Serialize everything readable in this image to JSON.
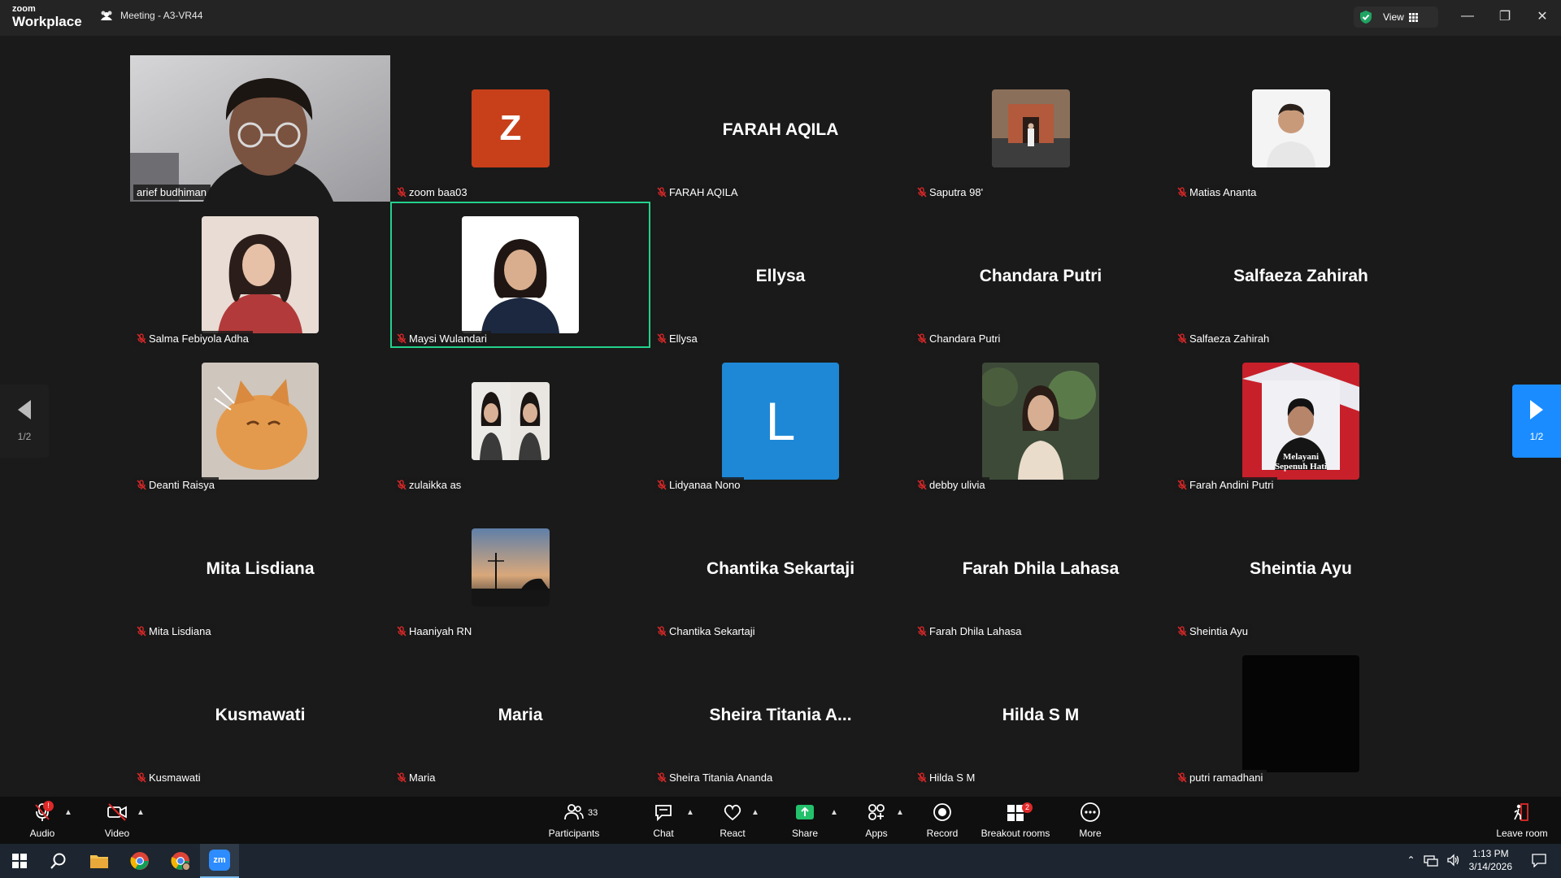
{
  "app": {
    "logo_small": "zoom",
    "logo_big": "Workplace",
    "meeting_title": "Meeting - A3-VR44",
    "view_label": "View"
  },
  "colors": {
    "active_speaker": "#23d18b",
    "zoom_blue": "#1a8cff",
    "mute_red": "#e02828"
  },
  "participants": [
    {
      "name": "arief budhiman",
      "type": "video"
    },
    {
      "name": "zoom baa03",
      "type": "initial",
      "initial": "Z",
      "color": "#c8401a"
    },
    {
      "name": "FARAH AQILA",
      "type": "text"
    },
    {
      "name": "Saputra 98'",
      "type": "photo",
      "photo": "building"
    },
    {
      "name": "Matias Ananta",
      "type": "photo",
      "photo": "portrait-male"
    },
    {
      "name": "Salma Febiyola Adha",
      "type": "photo-big",
      "photo": "portrait-red"
    },
    {
      "name": "Maysi Wulandari",
      "type": "photo-big",
      "photo": "portrait-white",
      "active": true
    },
    {
      "name": "Ellysa",
      "type": "text"
    },
    {
      "name": "Chandara Putri",
      "type": "text"
    },
    {
      "name": "Salfaeza Zahirah",
      "type": "text"
    },
    {
      "name": "Deanti Raisya",
      "type": "photo-big",
      "photo": "cat"
    },
    {
      "name": "zulaikka as",
      "type": "photo",
      "photo": "two-portraits"
    },
    {
      "name": "Lidyanaa Nono",
      "type": "initial-big",
      "initial": "L",
      "color": "#1e88d6"
    },
    {
      "name": "debby ulivia",
      "type": "photo-big",
      "photo": "plants"
    },
    {
      "name": "Farah Andini Putri",
      "type": "photo-big",
      "photo": "poster",
      "caption": "Melayani Sepenuh Hati"
    },
    {
      "name": "Mita Lisdiana",
      "type": "text"
    },
    {
      "name": "Haaniyah RN",
      "type": "photo",
      "photo": "sunset"
    },
    {
      "name": "Chantika Sekartaji",
      "type": "text"
    },
    {
      "name": "Farah Dhila Lahasa",
      "type": "text"
    },
    {
      "name": "Sheintia Ayu",
      "type": "text"
    },
    {
      "name": "Kusmawati",
      "type": "text"
    },
    {
      "name": "Maria",
      "type": "text"
    },
    {
      "name": "Sheira Titania Ananda",
      "type": "text",
      "display": "Sheira Titania A..."
    },
    {
      "name": "Hilda S M",
      "type": "text"
    },
    {
      "name": "putri ramadhani",
      "type": "photo-big",
      "photo": "black"
    }
  ],
  "pagination": {
    "left_label": "1/2",
    "right_label": "1/2"
  },
  "toolbar": {
    "audio": "Audio",
    "video": "Video",
    "participants": "Participants",
    "participants_count": "33",
    "chat": "Chat",
    "react": "React",
    "share": "Share",
    "apps": "Apps",
    "record": "Record",
    "breakout": "Breakout rooms",
    "breakout_badge": "2",
    "more": "More",
    "leave": "Leave room"
  },
  "taskbar": {
    "time": "1:13 PM",
    "date": "3/14/2026",
    "zoom_label": "zm"
  }
}
